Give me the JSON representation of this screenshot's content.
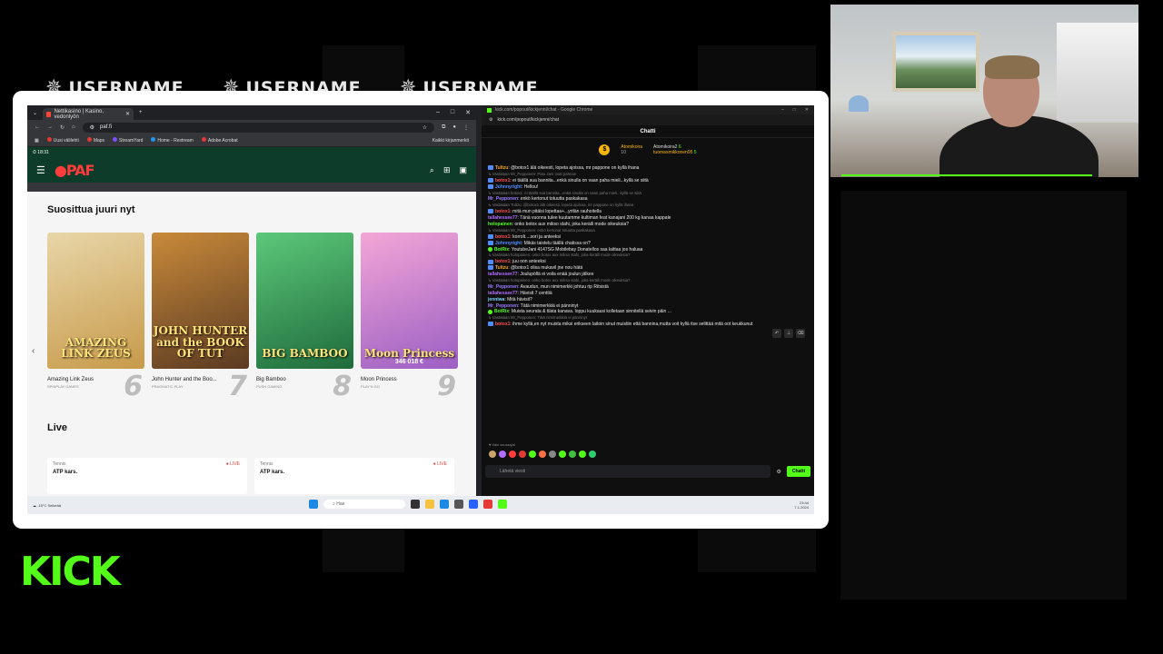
{
  "overlay": {
    "username_labels": [
      "USERNAME",
      "USERNAME",
      "USERNAME"
    ],
    "brand_logo": "KICK",
    "accent_color": "#53fc18"
  },
  "left_browser": {
    "tab_title": "Nettikasino | Kasino, vedonlyön",
    "new_tab": "+",
    "url": "paf.fi",
    "bookmarks": [
      "Uusi välilehti",
      "Maps",
      "StreamYard",
      "Home - Restream",
      "Adobe Acrobat"
    ],
    "bookmarks_right": "Kaikki kirjanmerkit",
    "clock": "18:31",
    "site_logo": "PAF",
    "section_popular": "Suosittua juuri nyt",
    "games": [
      {
        "art_text": "AMAZING LINK ZEUS",
        "title": "Amazing Link Zeus",
        "provider": "SPINPLAY GAMES",
        "rank": "6",
        "colors": [
          "#c79a4a",
          "#e8d6a8"
        ]
      },
      {
        "art_text": "JOHN HUNTER and the BOOK OF TUT",
        "title": "John Hunter and the Boo...",
        "provider": "PRAGMATIC PLAY",
        "rank": "7",
        "colors": [
          "#5a3a22",
          "#c98a3a"
        ]
      },
      {
        "art_text": "BIG BAMBOO",
        "title": "Big Bamboo",
        "provider": "PUSH GAMING",
        "rank": "8",
        "colors": [
          "#1f6b3b",
          "#5cc87a"
        ]
      },
      {
        "art_text": "Moon Princess",
        "title": "Moon Princess",
        "provider": "PLAY'N GO",
        "rank": "9",
        "jackpot": "346 018 €",
        "colors": [
          "#9b5fc4",
          "#f3a6d6"
        ]
      }
    ],
    "section_live": "Live",
    "live_cards": [
      {
        "sport": "Tennis",
        "event": "ATP kars.",
        "status": "LIVE"
      },
      {
        "sport": "Tennis",
        "event": "ATP kars.",
        "status": "LIVE"
      }
    ]
  },
  "chat_browser": {
    "window_title": "kick.com/popout/kickjenni/chat - Google Chrome",
    "url": "kick.com/popout/kickjenni/chat",
    "header": "Chatti",
    "pinned": {
      "user1": "Atomikoira",
      "count1": "10",
      "user2": "Atomikoira2",
      "count2": "6",
      "user3": "tuomasmikkonen95",
      "count3": "5"
    },
    "messages": [
      {
        "reply": "",
        "user": "Tultzu",
        "color": "#f5a623",
        "badge": "mod",
        "text": "@botox1 älä oikeesti, lopeta ajoissa, mr pappone on kyllä ihana"
      },
      {
        "reply": "Vastataan Mr_Pepponen: Pato Jani ovat pahnan",
        "user": "botox1",
        "color": "#ff4d4d",
        "badge": "mod",
        "text": "ei täällä sua bannita...enkä sinulla on vaan paha mieli...kyllä se siitä"
      },
      {
        "reply": "",
        "user": "Johnnyright",
        "color": "#4d8dff",
        "badge": "mod",
        "text": "Hellou!"
      },
      {
        "reply": "Vastataan botox1: ei täällä sua bannita...enkä sinulla on vaan paha mieli...kyllä se siitä",
        "user": "Mr_Pepponen",
        "color": "#9b7bff",
        "badge": "",
        "text": "enkö kertonut totuutta paskakasa"
      },
      {
        "reply": "Vastataan Tultzu: @botox1 älä oikeesti, lopeta ajoissa, mr pappone on kyllä ihana",
        "user": "botox1",
        "color": "#ff4d4d",
        "badge": "mod",
        "text": "mitä mun pitäisi lopettaa+...yritän rauhoitella"
      },
      {
        "reply": "",
        "user": "tallahessee77",
        "color": "#b06dff",
        "badge": "",
        "text": "Tänä vuonna tulee kuutamme kultiman feat kanajani 200 kg kanaa kappale"
      },
      {
        "reply": "",
        "user": "holopainen",
        "color": "#53fc18",
        "badge": "",
        "text": "onko botox aux mikso stahi, joka keräili mode oikeuksia?"
      },
      {
        "reply": "Vastataan Mr_Pepponen: enkö kertonut totuutta paskakasa",
        "user": "botox1",
        "color": "#ff4d4d",
        "badge": "mod",
        "text": "korrolt....sori ja anteeksi"
      },
      {
        "reply": "",
        "user": "Johnnyright",
        "color": "#4d8dff",
        "badge": "mod",
        "text": "Mikäs taistelu täällä chatissa on?"
      },
      {
        "reply": "",
        "user": "BotRix",
        "color": "#53fc18",
        "badge": "bot",
        "text": "YoutubeJani 4147SG Mobilebay Donatellos saa laittaa jos haluaa"
      },
      {
        "reply": "Vastataan holopainen: onko botox aux mikso stahi, joka keräili mode oikeuksia?",
        "user": "botox1",
        "color": "#ff4d4d",
        "badge": "mod",
        "text": "juu oon anteeksi"
      },
      {
        "reply": "",
        "user": "Tultzu",
        "color": "#f5a623",
        "badge": "mod",
        "text": "@botox1 olisa mukavil jne nou hätä"
      },
      {
        "reply": "",
        "user": "tallahessee77",
        "color": "#b06dff",
        "badge": "",
        "text": "Joulupöllä ei voila enää joulun jälkee"
      },
      {
        "reply": "Vastataan holopainen: onko botox aux mikso stahi, joka keräili mode oikeuksia?",
        "user": "Mr_Pepponen",
        "color": "#9b7bff",
        "badge": "",
        "text": "Avaudun, mun nimimerkki johtuu rip Ritsistä"
      },
      {
        "reply": "",
        "user": "tallahessee77",
        "color": "#b06dff",
        "badge": "",
        "text": "Hävisit 7 centtiä"
      },
      {
        "reply": "",
        "user": "jenniwa",
        "color": "#7fd4ff",
        "badge": "",
        "text": "Mitä hävisit?"
      },
      {
        "reply": "",
        "user": "Mr_Pepponen",
        "color": "#9b7bff",
        "badge": "",
        "text": "Tätä nimimerkkiä ei pänninyt"
      },
      {
        "reply": "",
        "user": "BotRix",
        "color": "#53fc18",
        "badge": "bot",
        "text": "Muista seurata & tilata kanava. loppu kuukausi kolletaan sinnitellä seivin päin ..."
      },
      {
        "reply": "Vastataan Mr_Pepponen: Tätä nimimerkkiä ei pänninyt",
        "user": "botox1",
        "color": "#ff4d4d",
        "badge": "mod",
        "text": "ihme kyllä,en nyt muista miksi erikseen laitoin sinut muistiin että bannina,mutta voit kyllä itse selittää mitä oot keukkunut"
      }
    ],
    "only_followers": "Vain seuraajat",
    "input_placeholder": "Lähetä viesti",
    "send_button": "Chatti"
  },
  "taskbar": {
    "weather": "-15°C Selkeää",
    "search": "Hae",
    "time": "23:44",
    "date": "7.1.2024"
  }
}
